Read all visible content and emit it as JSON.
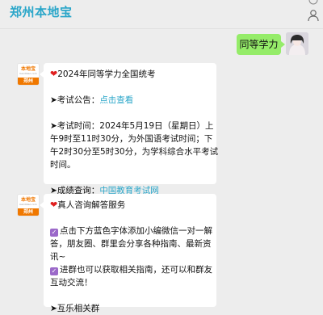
{
  "header": {
    "title": "郑州本地宝",
    "more_glyph": "···"
  },
  "outgoing": {
    "text": "同等学力"
  },
  "bot": {
    "logo_text": "本地宝",
    "logo_sub": "bendibao.com",
    "band_text": "郑州"
  },
  "msg1": {
    "heading": "2024年同等学力全国统考",
    "notice_prefix": "➤考试公告：",
    "notice_link": "点击查看",
    "time_lines": [
      "➤考试时间：2024年5月19日（星期日）上",
      "午9时至11时30分，为外国语考试时间；下",
      "午2时30分至5时30分，为学科综合水平考试",
      "时间。"
    ],
    "score_prefix": "➤成绩查询：",
    "score_link": "中国教育考试网"
  },
  "msg2": {
    "heading": "真人咨询解答服务",
    "check_glyph": "✓",
    "body_lines": [
      "点击下方蓝色字体添加小编微信一对一解",
      "答，朋友圈、群里会分享各种指南、最新资",
      "讯~"
    ],
    "group_lines": [
      "进群也可以获取相关指南，还可以和群友",
      "互动交流！"
    ],
    "more_prefix": "➤互乐相关群"
  },
  "colors": {
    "brand": "#2aa6c9",
    "bubble_out": "#95ec69",
    "bubble_in": "#ffffff",
    "background": "#ededed",
    "logo_orange": "#f07800",
    "heart": "#e02020"
  }
}
